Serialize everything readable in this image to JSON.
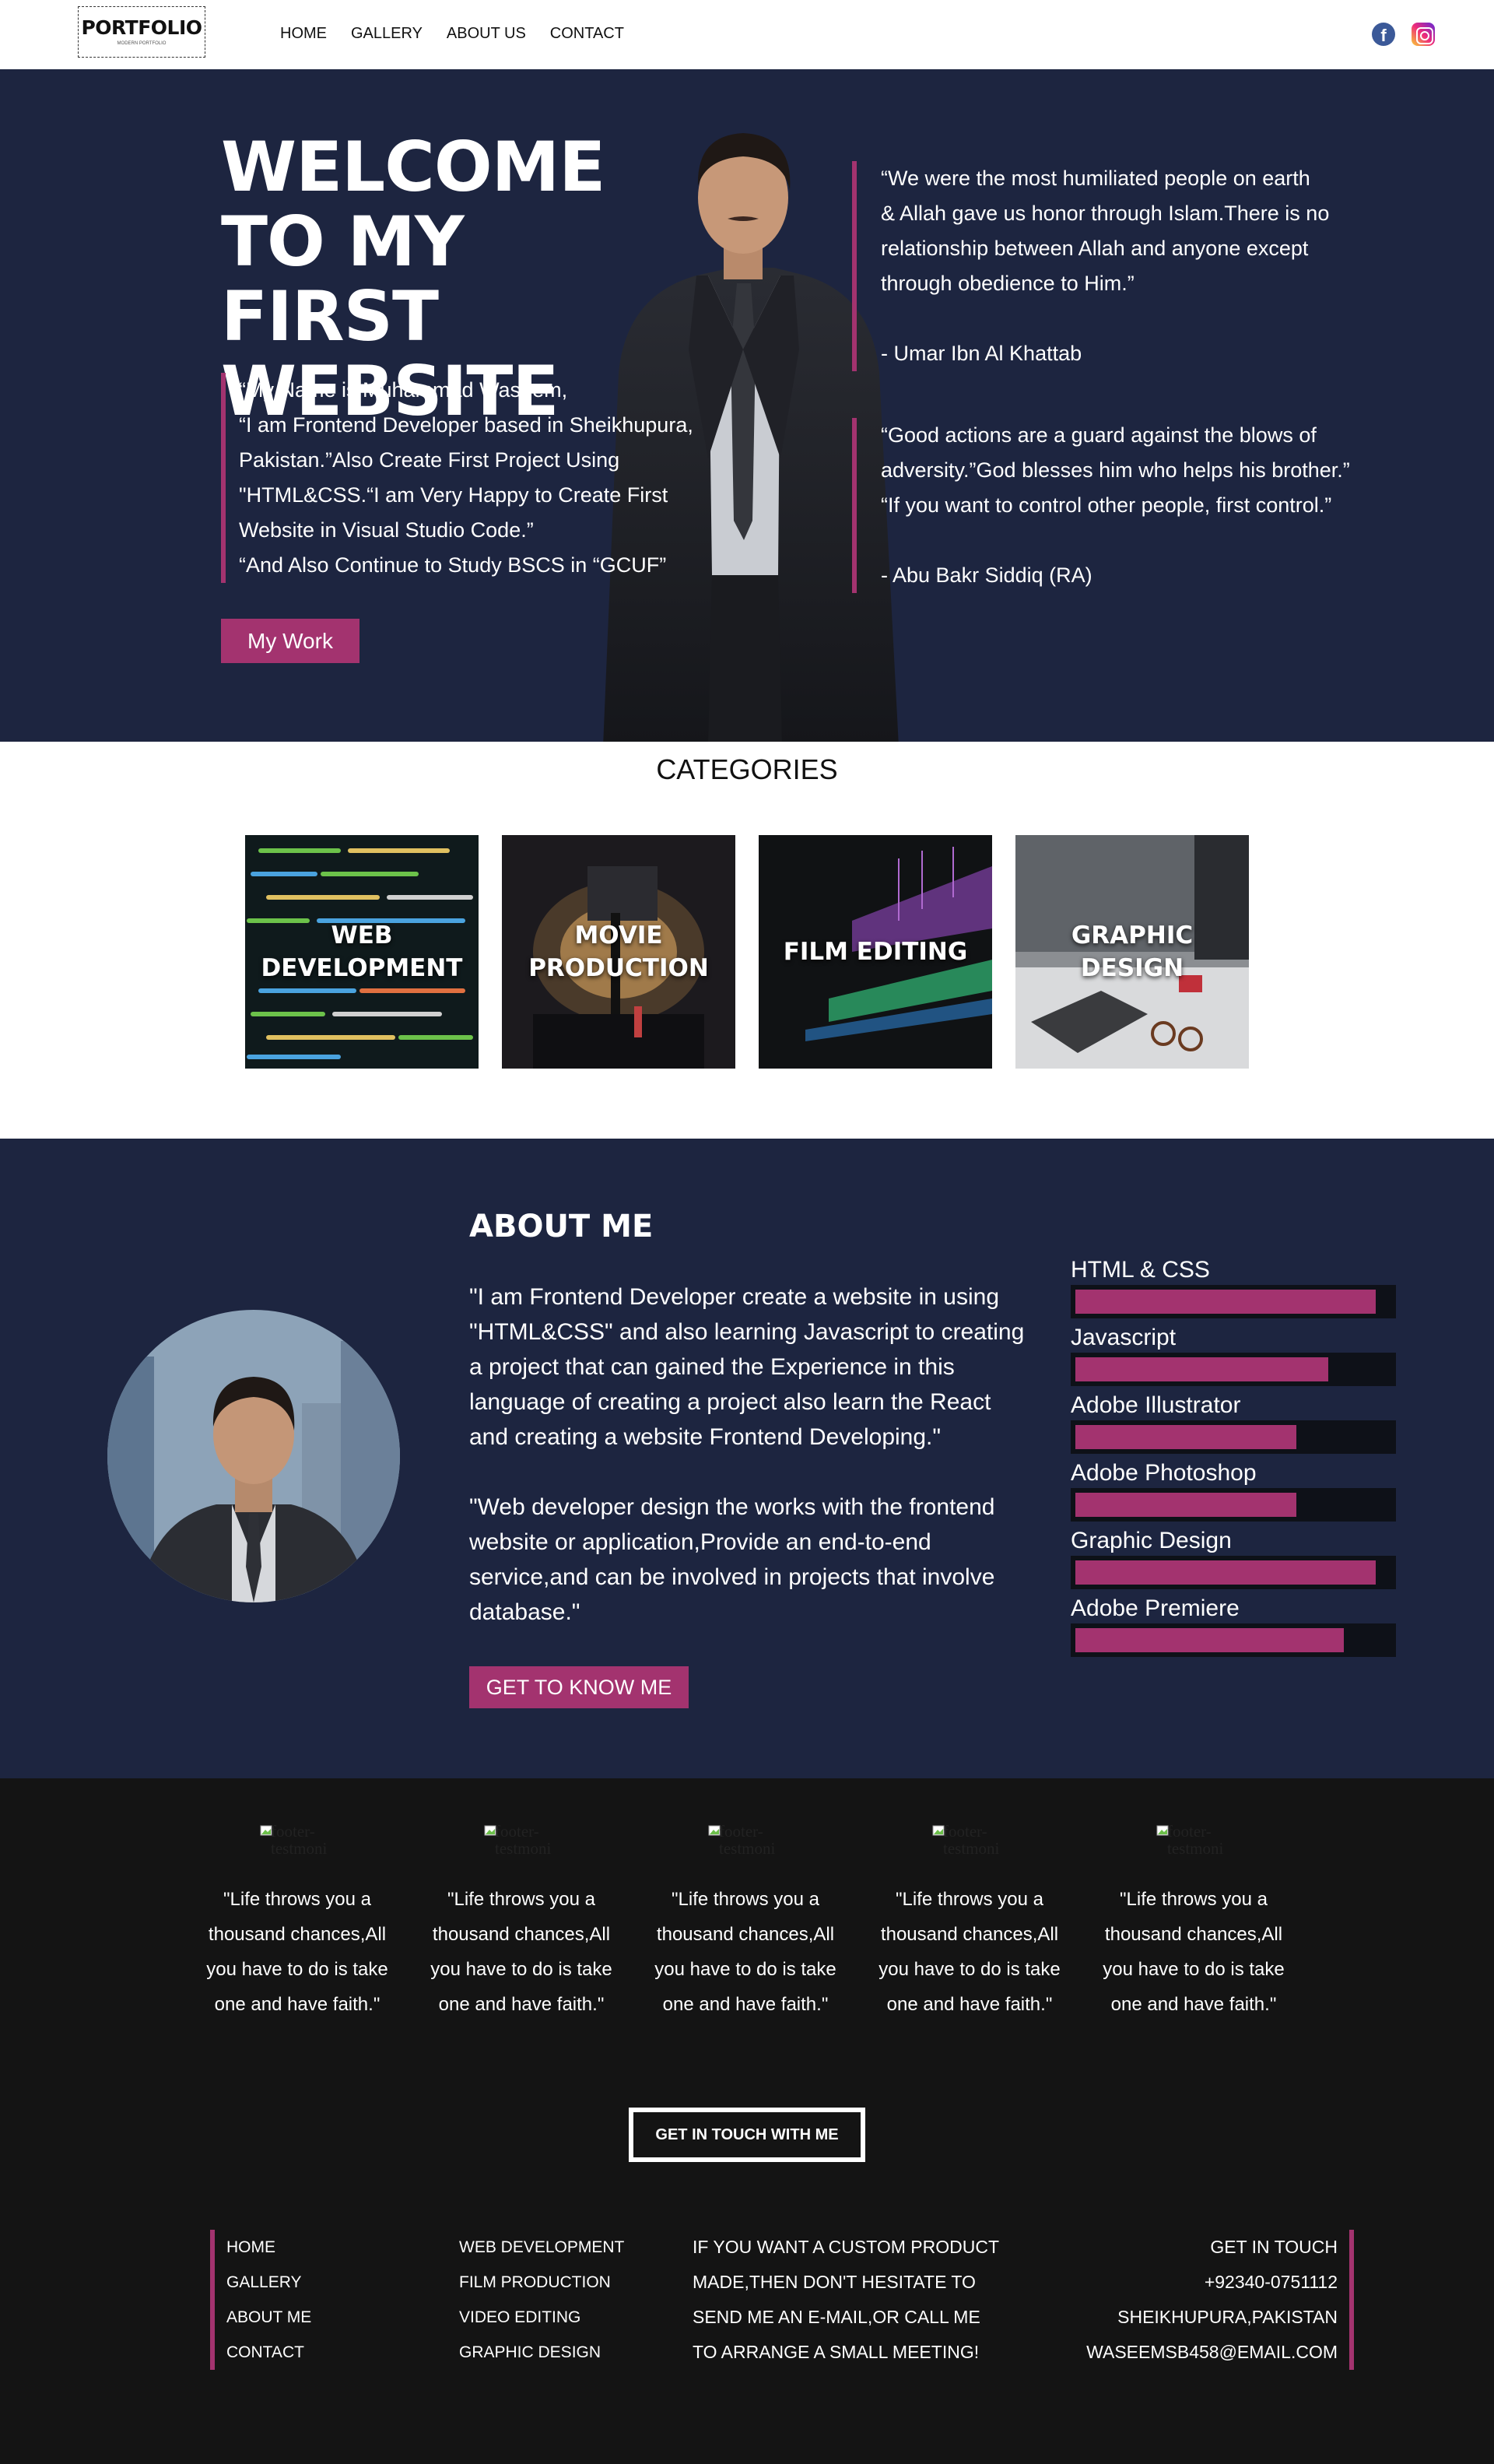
{
  "nav": {
    "logo_main": "PORTFOLIO",
    "logo_sub": "MODERN PORTFOLIO",
    "links": [
      "HOME",
      "GALLERY",
      "ABOUT US",
      "CONTACT"
    ],
    "social": [
      {
        "icon": "facebook-icon",
        "glyph": "f",
        "color": "#3b5998"
      },
      {
        "icon": "instagram-icon",
        "color": "#e1306c"
      }
    ]
  },
  "hero": {
    "title_lines": [
      "WELCOME",
      "TO MY FIRST",
      "WEBSITE"
    ],
    "intro": [
      "“My Name is Muhammad Waseem,",
      "“I am Frontend Developer based in Sheikhupura,",
      "Pakistan.”Also Create First Project Using",
      "\"HTML&CSS.“I am Very Happy to Create First",
      "Website in Visual Studio Code.”",
      "“And Also Continue to Study BSCS in “GCUF”"
    ],
    "button": "My Work",
    "quote1": [
      "“We were the most humiliated people on earth",
      "& Allah gave us honor through Islam.There is no",
      "relationship between Allah and anyone except",
      "through obedience to Him.”",
      "",
      "- Umar Ibn Al Khattab"
    ],
    "quote2": [
      "“Good actions are a guard against the blows of",
      "adversity.”God blesses him who helps his brother.”",
      "“If you want to control other people, first control.”",
      "",
      "- Abu Bakr Siddiq (RA)"
    ]
  },
  "categories": {
    "title": "CATEGORIES",
    "items": [
      "WEB DEVELOPMENT",
      "MOVIE PRODUCTION",
      "FILM EDITING",
      "GRAPHIC DESIGN"
    ]
  },
  "about": {
    "heading": "ABOUT ME",
    "paragraph1": "\"I am Frontend Developer create a website in using \"HTML&CSS\" and also learning Javascript to creating a project that can gained the Experience in this language of creating a project also learn the React and creating a website Frontend Developing.\"",
    "paragraph2": "\"Web developer design the works with the frontend website or application,Provide an end-to-end service,and can be involved in projects that involve database.\"",
    "button": "GET TO KNOW ME",
    "skills": [
      {
        "name": "HTML & CSS",
        "level": 0.95
      },
      {
        "name": "Javascript",
        "level": 0.8
      },
      {
        "name": "Adobe Illustrator",
        "level": 0.7
      },
      {
        "name": "Adobe Photoshop",
        "level": 0.7
      },
      {
        "name": "Graphic Design",
        "level": 0.95
      },
      {
        "name": "Adobe Premiere",
        "level": 0.85
      }
    ]
  },
  "footer": {
    "testimonial_img_alt": "footer-testmoni",
    "testimonial_text": "\"Life throws you a thousand chances,All you have to do is take one and have faith.\"",
    "testimonial_count": 5,
    "cta_button": "GET IN TOUCH WITH ME",
    "col1_links": [
      "HOME",
      "GALLERY",
      "ABOUT ME",
      "CONTACT"
    ],
    "col2_links": [
      "WEB DEVELOPMENT",
      "FILM PRODUCTION",
      "VIDEO EDITING",
      "GRAPHIC DESIGN"
    ],
    "col3_text": [
      "IF YOU WANT A CUSTOM PRODUCT",
      "MADE,THEN DON'T HESITATE TO",
      "SEND ME AN E-MAIL,OR CALL ME",
      "TO ARRANGE A SMALL MEETING!"
    ],
    "col4_text": [
      "GET IN TOUCH",
      "+92340-0751112",
      "SHEIKHUPURA,PAKISTAN",
      "WASEEMSB458@EMAIL.COM"
    ]
  },
  "colors": {
    "navy": "#1d2540",
    "accent": "#a3336f",
    "footer_bg": "#141414"
  }
}
